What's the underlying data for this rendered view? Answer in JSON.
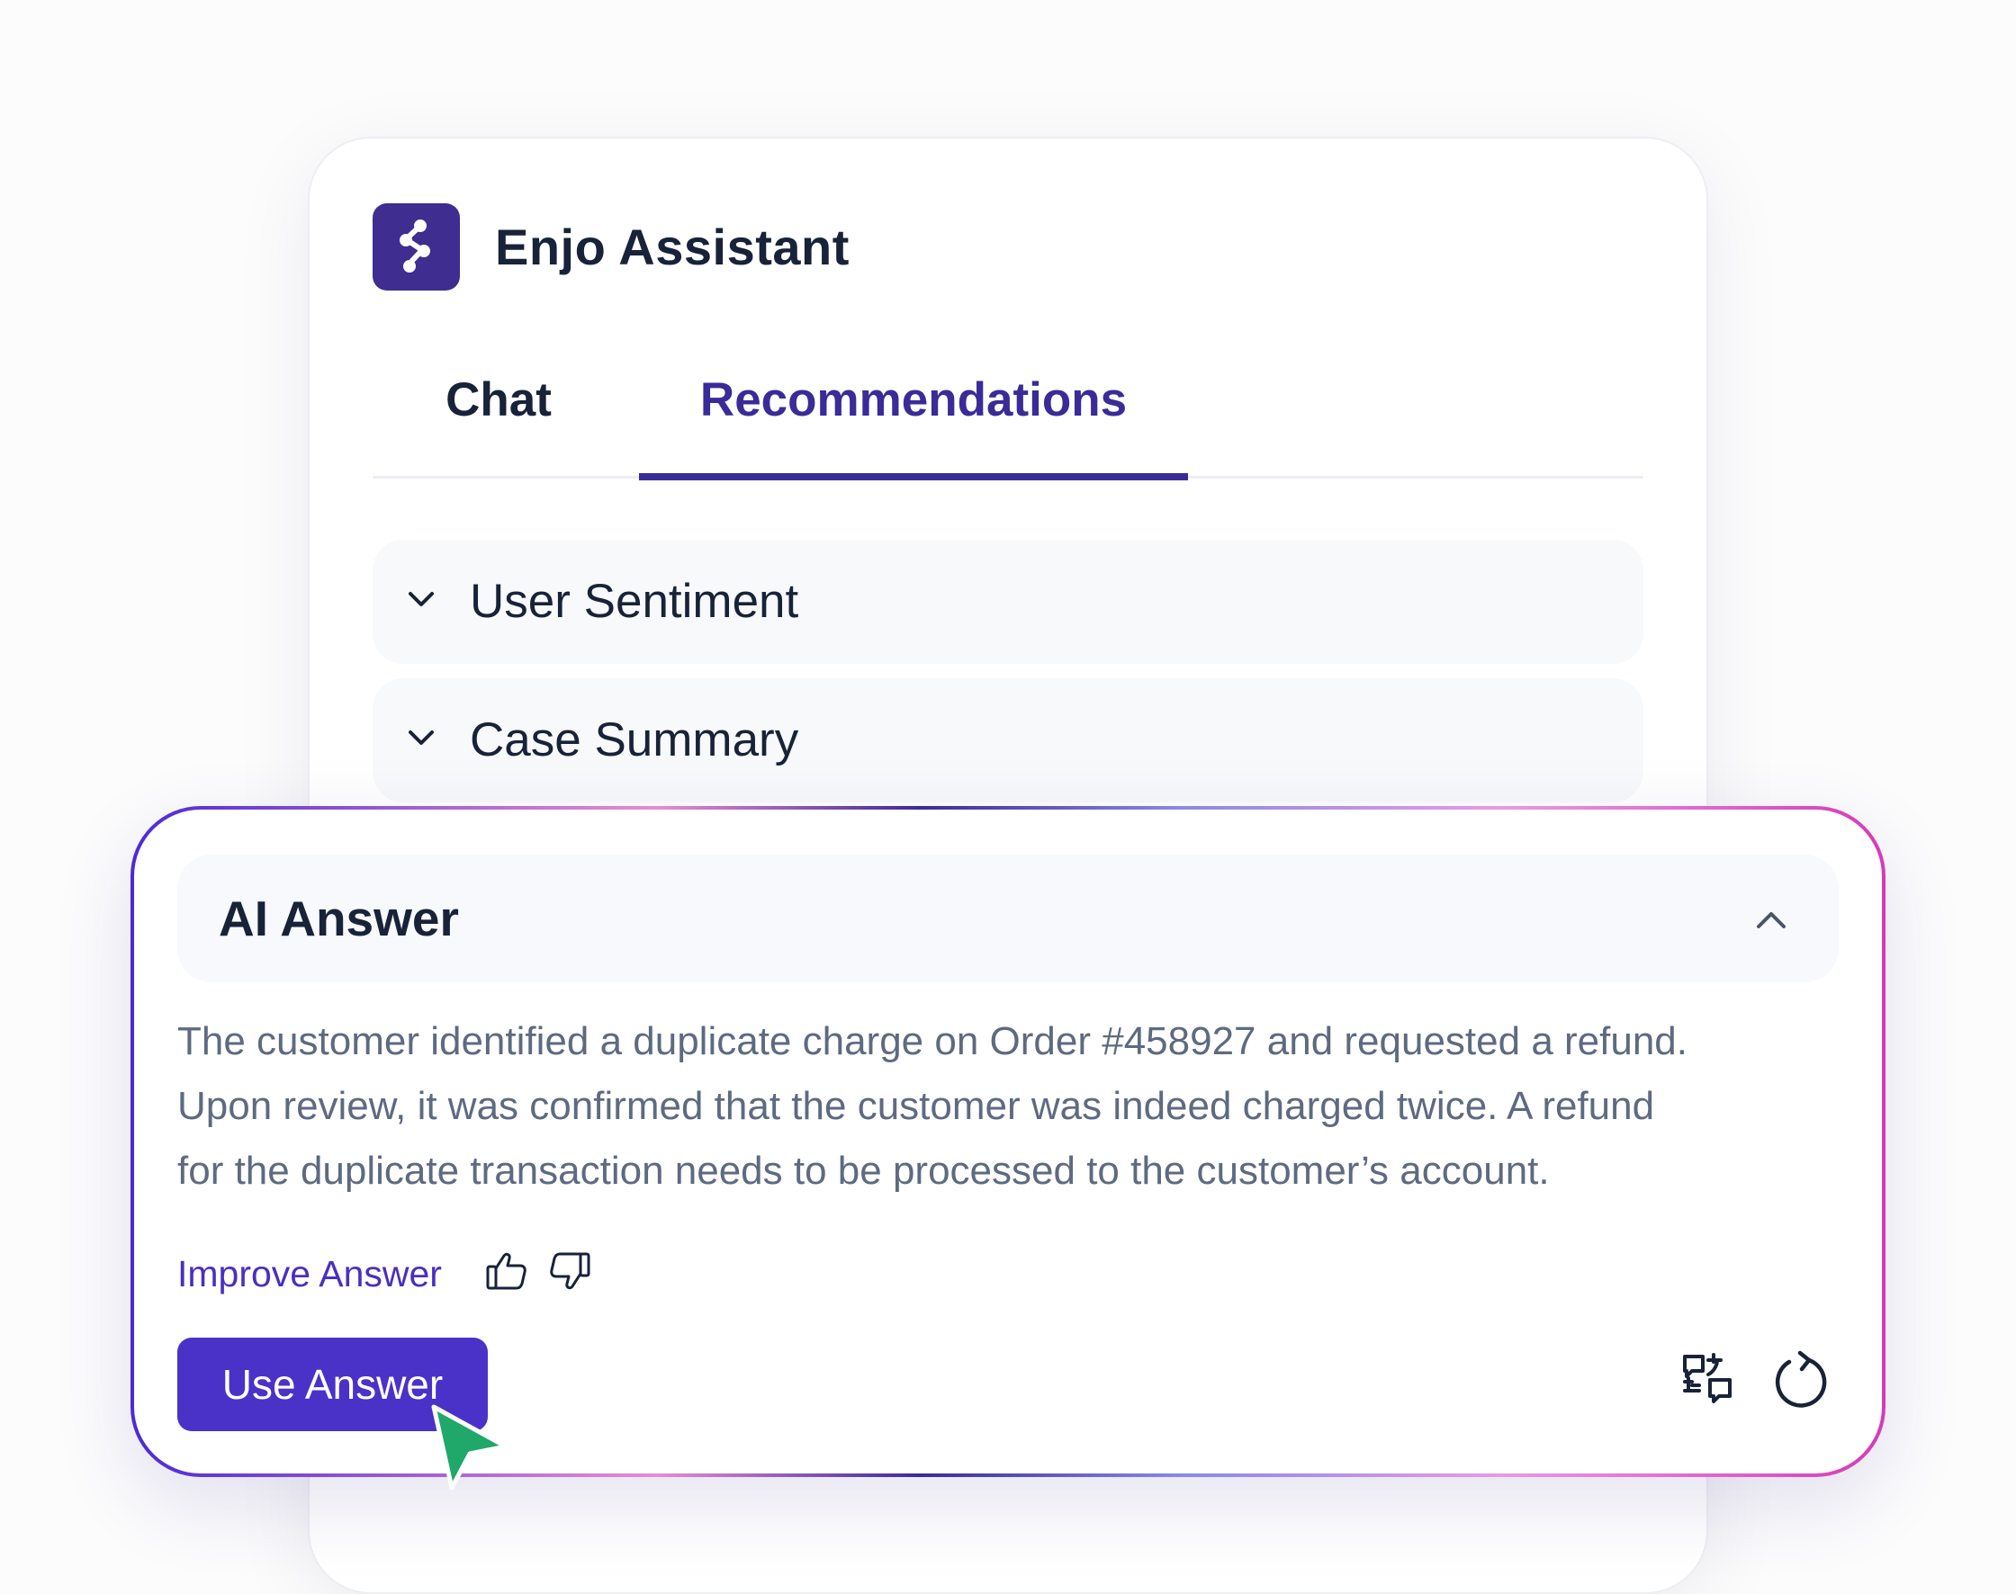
{
  "app": {
    "title": "Enjo Assistant",
    "logo_icon": "enjo-logo-icon",
    "brand_color": "#3f2d8f"
  },
  "tabs": [
    {
      "label": "Chat",
      "active": false
    },
    {
      "label": "Recommendations",
      "active": true
    }
  ],
  "accordions": [
    {
      "label": "User Sentiment",
      "icon": "chevron-down-icon",
      "expanded": false
    },
    {
      "label": "Case Summary",
      "icon": "chevron-down-icon",
      "expanded": false
    }
  ],
  "ai_answer": {
    "title": "AI Answer",
    "icon": "chevron-up-icon",
    "expanded": true,
    "body_lines": [
      "The customer identified a duplicate charge on Order #458927 and requested a refund.",
      "Upon review, it was confirmed that the customer was indeed charged twice. A refund",
      "for the duplicate transaction needs to be processed to the customer’s account."
    ],
    "improve_label": "Improve Answer",
    "feedback_icons": [
      "thumbs-up-icon",
      "thumbs-down-icon"
    ],
    "use_button_label": "Use Answer",
    "action_icons": [
      "translate-icon",
      "refresh-icon"
    ],
    "accent_color": "#4a32c8"
  }
}
